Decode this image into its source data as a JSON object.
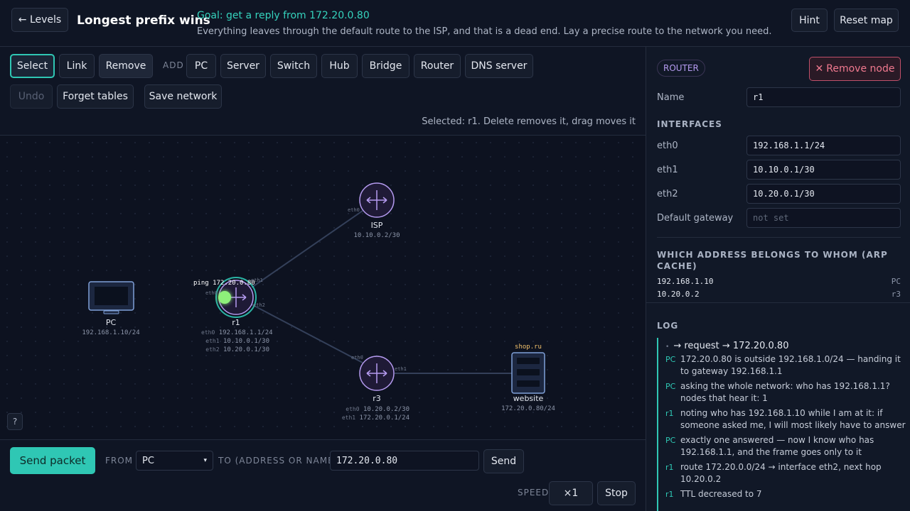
{
  "header": {
    "back_label": "← Levels",
    "level_title": "Longest prefix wins",
    "goal": "Goal: get a reply from 172.20.0.80",
    "description": "Everything leaves through the default route to the ISP, and that is a dead end. Lay a precise route to the network you need.",
    "hint_label": "Hint",
    "reset_label": "Reset map"
  },
  "toolbar": {
    "select_label": "Select",
    "link_label": "Link",
    "remove_label": "Remove",
    "add_label": "ADD",
    "add_items": [
      "PC",
      "Server",
      "Switch",
      "Hub",
      "Bridge",
      "Router",
      "DNS server"
    ],
    "undo_label": "Undo",
    "forget_label": "Forget tables",
    "save_label": "Save network",
    "selected_info": "Selected: r1. Delete removes it, drag moves it"
  },
  "canvas": {
    "packet_label": "ping 172.20.0.80",
    "help_label": "?",
    "nodes": {
      "pc": {
        "name": "PC",
        "addr": "192.168.1.10/24"
      },
      "isp": {
        "name": "ISP",
        "addr": "10.10.0.2/30",
        "port": "eth0"
      },
      "r1": {
        "name": "r1",
        "ifaces": [
          {
            "name": "eth0",
            "addr": "192.168.1.1/24"
          },
          {
            "name": "eth1",
            "addr": "10.10.0.1/30"
          },
          {
            "name": "eth2",
            "addr": "10.20.0.1/30"
          }
        ],
        "ports": [
          "eth0",
          "eth1",
          "eth2"
        ]
      },
      "r3": {
        "name": "r3",
        "ifaces": [
          {
            "name": "eth0",
            "addr": "10.20.0.2/30"
          },
          {
            "name": "eth1",
            "addr": "172.20.0.1/24"
          }
        ],
        "ports": [
          "eth0",
          "eth1"
        ]
      },
      "website": {
        "name": "website",
        "domain": "shop.ru",
        "addr": "172.20.0.80/24"
      }
    }
  },
  "bottom": {
    "send_packet_label": "Send packet",
    "from_label": "FROM",
    "from_value": "PC",
    "to_label": "TO (ADDRESS OR NAME)",
    "to_value": "172.20.0.80",
    "send_label": "Send",
    "speed_label": "SPEED",
    "speed_value": "×1",
    "stop_label": "Stop"
  },
  "panel": {
    "badge": "ROUTER",
    "remove_node_label": "Remove node",
    "name_label": "Name",
    "name_value": "r1",
    "interfaces_title": "INTERFACES",
    "interfaces": [
      {
        "name": "eth0",
        "value": "192.168.1.1/24"
      },
      {
        "name": "eth1",
        "value": "10.10.0.1/30"
      },
      {
        "name": "eth2",
        "value": "10.20.0.1/30"
      }
    ],
    "gateway_label": "Default gateway",
    "gateway_placeholder": "not set",
    "arp_title": "WHICH ADDRESS BELONGS TO WHOM (ARP CACHE)",
    "arp": [
      {
        "addr": "192.168.1.10",
        "owner": "PC"
      },
      {
        "addr": "10.20.0.2",
        "owner": "r3"
      }
    ],
    "log_title": "LOG",
    "log_request": "→ request → 172.20.0.80",
    "log": [
      {
        "who": "PC",
        "text": "172.20.0.80 is outside 192.168.1.0/24 — handing it to gateway 192.168.1.1"
      },
      {
        "who": "PC",
        "text": "asking the whole network: who has 192.168.1.1? nodes that hear it: 1"
      },
      {
        "who": "r1",
        "text": "noting who has 192.168.1.10 while I am at it: if someone asked me, I will most likely have to answer"
      },
      {
        "who": "PC",
        "text": "exactly one answered — now I know who has 192.168.1.1, and the frame goes only to it"
      },
      {
        "who": "r1",
        "text": "route 172.20.0.0/24 → interface eth2, next hop 10.20.0.2"
      },
      {
        "who": "r1",
        "text": "TTL decreased to 7"
      }
    ]
  },
  "colors": {
    "accent": "#2fc7b4",
    "router": "#b59bf0",
    "host": "#7fa0d8",
    "danger": "#f0798f",
    "domain": "#f3c26b"
  }
}
